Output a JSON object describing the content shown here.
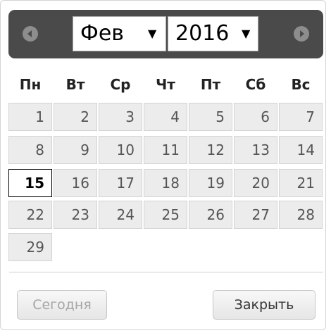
{
  "header": {
    "month": "Фев",
    "year": "2016",
    "prev_icon": "left-arrow-icon",
    "next_icon": "right-arrow-icon"
  },
  "weekdays": [
    "Пн",
    "Вт",
    "Ср",
    "Чт",
    "Пт",
    "Сб",
    "Вс"
  ],
  "weeks": [
    [
      "1",
      "2",
      "3",
      "4",
      "5",
      "6",
      "7"
    ],
    [
      "8",
      "9",
      "10",
      "11",
      "12",
      "13",
      "14"
    ],
    [
      "15",
      "16",
      "17",
      "18",
      "19",
      "20",
      "21"
    ],
    [
      "22",
      "23",
      "24",
      "25",
      "26",
      "27",
      "28"
    ],
    [
      "29"
    ]
  ],
  "selected_day": "15",
  "footer": {
    "today_label": "Сегодня",
    "close_label": "Закрыть"
  },
  "colors": {
    "header_bg": "#4a4a4a",
    "day_bg": "#ececec",
    "nav_icon": "#8d8d8d"
  }
}
